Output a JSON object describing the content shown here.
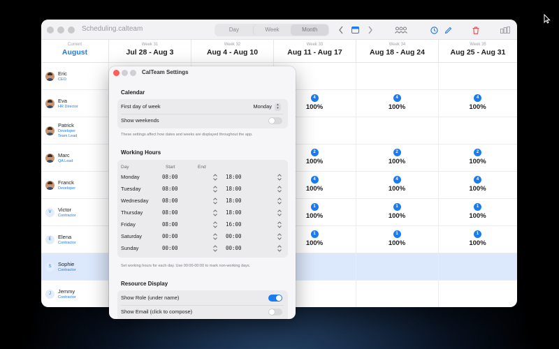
{
  "window": {
    "title": "Scheduling.calteam",
    "view_modes": [
      "Day",
      "Week",
      "Month"
    ],
    "active_view": "Month"
  },
  "toolbar_icons": [
    "chevron-left-icon",
    "calendar-icon",
    "chevron-right-icon",
    "people-icon",
    "clock-icon",
    "pencil-icon",
    "trash-icon",
    "columns-icon"
  ],
  "calendar": {
    "current_label": "Current",
    "current_month": "August",
    "weeks": [
      {
        "week": "Week 31",
        "range": "Jul 28 - Aug 3"
      },
      {
        "week": "Week 32",
        "range": "Aug 4 - Aug 10"
      },
      {
        "week": "Week 33",
        "range": "Aug 11 - Aug 17"
      },
      {
        "week": "Week 34",
        "range": "Aug 18 - Aug 24"
      },
      {
        "week": "Week 35",
        "range": "Aug 25 - Aug 31"
      }
    ],
    "people": [
      {
        "name": "Eric",
        "role": [
          "CEO"
        ],
        "avatar": "photo",
        "initial": ""
      },
      {
        "name": "Eva",
        "role": [
          "HR Director"
        ],
        "avatar": "photo",
        "initial": ""
      },
      {
        "name": "Patrick",
        "role": [
          "Developer",
          "Team Lead"
        ],
        "avatar": "photo",
        "initial": ""
      },
      {
        "name": "Marc",
        "role": [
          "QA Lead"
        ],
        "avatar": "photo",
        "initial": ""
      },
      {
        "name": "Franck",
        "role": [
          "Developer"
        ],
        "avatar": "photo",
        "initial": ""
      },
      {
        "name": "Victor",
        "role": [
          "Contractor"
        ],
        "avatar": "initial",
        "initial": "V"
      },
      {
        "name": "Elena",
        "role": [
          "Contractor"
        ],
        "avatar": "initial",
        "initial": "E"
      },
      {
        "name": "Sophie",
        "role": [
          "Contractor"
        ],
        "avatar": "initial",
        "initial": "S"
      },
      {
        "name": "Jemmy",
        "role": [
          "Contractor"
        ],
        "avatar": "initial",
        "initial": "J"
      }
    ],
    "visible_allocations": [
      {
        "row": 1,
        "weeks": [
          3,
          4,
          5
        ],
        "badge": "4",
        "percent": "100%"
      },
      {
        "row": 3,
        "weeks": [
          3,
          4,
          5
        ],
        "badge": "2",
        "percent": "100%"
      },
      {
        "row": 4,
        "weeks": [
          3,
          4,
          5
        ],
        "badge": "4",
        "percent": "100%"
      },
      {
        "row": 5,
        "weeks": [
          3,
          4,
          5
        ],
        "badge": "1",
        "percent": "100%"
      },
      {
        "row": 6,
        "weeks": [
          3,
          4,
          5
        ],
        "badge": "1",
        "percent": "100%"
      }
    ],
    "selected_row": 7
  },
  "settings": {
    "title": "CalTeam Settings",
    "calendar_section": {
      "title": "Calendar",
      "first_day_label": "First day of week",
      "first_day_value": "Monday",
      "show_weekends_label": "Show weekends",
      "show_weekends_on": false,
      "note": "These settings affect how dates and weeks are displayed throughout the app."
    },
    "working_hours": {
      "title": "Working Hours",
      "col_day": "Day",
      "col_start": "Start",
      "col_end": "End",
      "days": [
        {
          "day": "Monday",
          "start": "08:00",
          "end": "18:00"
        },
        {
          "day": "Tuesday",
          "start": "08:00",
          "end": "18:00"
        },
        {
          "day": "Wednesday",
          "start": "08:00",
          "end": "18:00"
        },
        {
          "day": "Thursday",
          "start": "08:00",
          "end": "18:00"
        },
        {
          "day": "Friday",
          "start": "08:00",
          "end": "16:00"
        },
        {
          "day": "Saturday",
          "start": "00:00",
          "end": "00:00"
        },
        {
          "day": "Sunday",
          "start": "00:00",
          "end": "00:00"
        }
      ],
      "note": "Set working hours for each day. Use 00:00-00:00 to mark non-working days."
    },
    "resource_display": {
      "title": "Resource Display",
      "show_role_label": "Show Role (under name)",
      "show_role_on": true,
      "show_email_label": "Show Email (click to compose)",
      "show_email_on": false
    }
  },
  "colors": {
    "accent": "#1a7cf0",
    "selected_row": "#dce8fb",
    "close_button": "#ff5f57",
    "trash": "#e5484d"
  }
}
